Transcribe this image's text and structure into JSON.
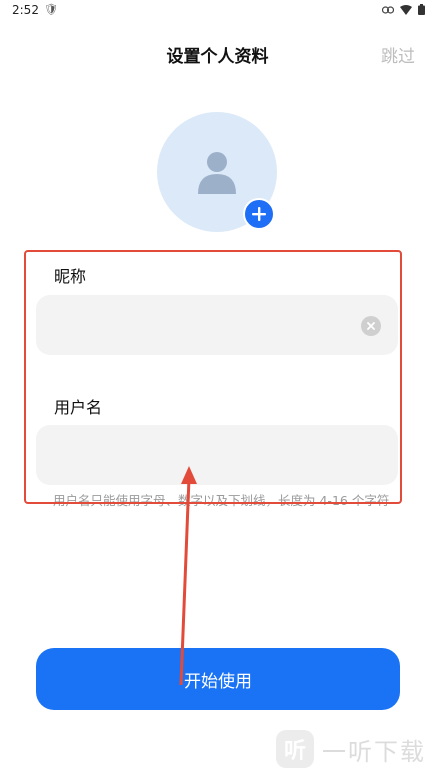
{
  "status": {
    "time": "2:52"
  },
  "header": {
    "title": "设置个人资料",
    "skip": "跳过"
  },
  "form": {
    "nickname_label": "昵称",
    "nickname_value": "",
    "username_label": "用户名",
    "username_value": "",
    "hint": "用户名只能使用字母、数字以及下划线，长度为 4-16 个字符"
  },
  "actions": {
    "start": "开始使用"
  },
  "annotation": {
    "box_color": "#e24b3a",
    "arrow_color": "#e24b3a"
  },
  "watermark": {
    "logo_char": "听",
    "text": "一听下载"
  },
  "colors": {
    "primary": "#1a73f5",
    "avatar_bg": "#dbe9f8",
    "field_bg": "#f3f3f3"
  }
}
